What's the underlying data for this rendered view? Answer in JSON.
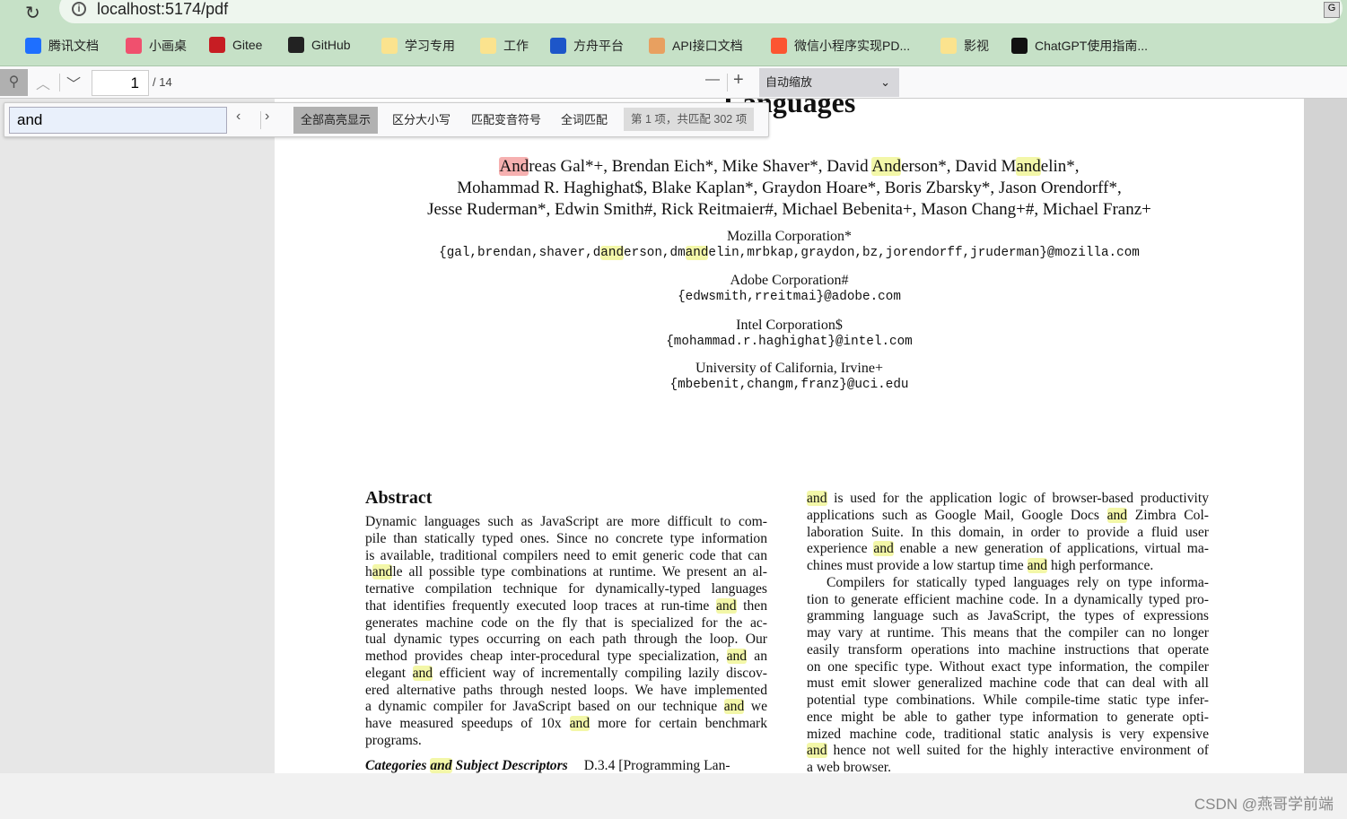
{
  "browser": {
    "url": "localhost:5174/pdf",
    "back": "›",
    "reload": "↻"
  },
  "bookmarks": [
    {
      "label": "腾讯文档",
      "icon": "tencent-docs-icon",
      "color": "#1e6fff"
    },
    {
      "label": "小画桌",
      "icon": "xiaohuazhuo-icon",
      "color": "#f0506e"
    },
    {
      "label": "Gitee",
      "icon": "gitee-icon",
      "color": "#c71d23"
    },
    {
      "label": "GitHub",
      "icon": "github-icon",
      "color": "#222222"
    },
    {
      "label": "学习专用",
      "icon": "folder-icon",
      "color": "#fbe38e"
    },
    {
      "label": "工作",
      "icon": "folder-icon",
      "color": "#fbe38e"
    },
    {
      "label": "方舟平台",
      "icon": "fangzhou-icon",
      "color": "#1d56c9"
    },
    {
      "label": "API接口文档",
      "icon": "doc-icon",
      "color": "#e8a060"
    },
    {
      "label": "微信小程序实现PD...",
      "icon": "csdn-icon",
      "color": "#fc5531"
    },
    {
      "label": "影视",
      "icon": "folder-icon",
      "color": "#fbe38e"
    },
    {
      "label": "ChatGPT使用指南...",
      "icon": "file-icon",
      "color": "#111111"
    }
  ],
  "toolbar": {
    "page": "1",
    "page_total": "/ 14",
    "zoom": "自动缩放",
    "zoom_out": "—",
    "zoom_in": "+"
  },
  "find": {
    "query": "and",
    "highlight_all": "全部高亮显示",
    "match_case": "区分大小写",
    "match_diacritics": "匹配变音符号",
    "whole_words": "全词匹配",
    "result": "第 1 项，共匹配 302 项"
  },
  "paper": {
    "title_fragment": "Languages",
    "authors": [
      [
        {
          "cur": "And"
        },
        "reas Gal*+, Brendan Eich*, Mike Shaver*, David ",
        {
          "hl": "And"
        },
        "erson*, David M",
        {
          "hl": "and"
        },
        "elin*,"
      ],
      [
        "Mohammad R. Haghighat$, Blake Kaplan*, Graydon Hoare*, Boris Zbarsky*, Jason Orendorff*,"
      ],
      [
        "Jesse Ruderman*, Edwin Smith#, Rick Reitmaier#, Michael Bebenita+, Mason Chang+#, Michael Franz+"
      ]
    ],
    "affiliations": [
      {
        "name": "Mozilla Corporation*",
        "emails": [
          "{gal,brendan,shaver,d",
          {
            "hl": "and"
          },
          "erson,dm",
          {
            "hl": "and"
          },
          "elin,mrbkap,graydon,bz,jorendorff,jruderman}@mozilla.com"
        ]
      },
      {
        "name": "Adobe Corporation#",
        "emails": [
          "{edwsmith,rreitmai}@adobe.com"
        ]
      },
      {
        "name": "Intel Corporation$",
        "emails": [
          "{mohammad.r.haghighat}@intel.com"
        ]
      },
      {
        "name": "University of California, Irvine+",
        "emails": [
          "{mbebenit,changm,franz}@uci.edu"
        ]
      }
    ],
    "abstract_heading": "Abstract",
    "abstract_lines": [
      [
        "Dynamic languages such as JavaScript are more difficult to com-"
      ],
      [
        "pile than statically typed ones. Since no concrete type information"
      ],
      [
        "is available, traditional compilers need to emit generic code that can"
      ],
      [
        "h",
        {
          "hl": "and"
        },
        "le all possible type combinations at runtime. We present an al-"
      ],
      [
        "ternative compilation technique for dynamically-typed languages"
      ],
      [
        "that identifies frequently executed loop traces at run-time ",
        {
          "hl": "and"
        },
        " then"
      ],
      [
        "generates machine code on the fly that is specialized for the ac-"
      ],
      [
        "tual dynamic types occurring on each path through the loop. Our"
      ],
      [
        "method provides cheap inter-procedural type specialization, ",
        {
          "hl": "and"
        },
        " an"
      ],
      [
        "elegant ",
        {
          "hl": "and"
        },
        " efficient way of incrementally compiling lazily discov-"
      ],
      [
        "ered alternative paths through nested loops. We have implemented"
      ],
      [
        "a dynamic compiler for JavaScript based on our technique ",
        {
          "hl": "and"
        },
        " we"
      ],
      [
        "have measured speedups of 10x ",
        {
          "hl": "and"
        },
        " more for certain benchmark"
      ],
      [
        "programs."
      ]
    ],
    "categories_line": [
      "Categories ",
      {
        "hl": "and"
      },
      " Subject Descriptors",
      "D.3.4 [Programming Lan-"
    ],
    "right_lines": [
      [
        {
          "hl": "and"
        },
        " is used for the application logic of browser-based productivity"
      ],
      [
        "applications such as Google Mail, Google Docs ",
        {
          "hl": "and"
        },
        " Zimbra Col-"
      ],
      [
        "laboration Suite. In this domain, in order to provide a fluid user"
      ],
      [
        "experience ",
        {
          "hl": "and"
        },
        " enable a new generation of applications, virtual ma-"
      ],
      [
        "chines must provide a low startup time ",
        {
          "hl": "and"
        },
        " high performance."
      ],
      [
        "Compilers for statically typed languages rely on type informa-"
      ],
      [
        "tion to generate efficient machine code. In a dynamically typed pro-"
      ],
      [
        "gramming language such as JavaScript, the types of expressions"
      ],
      [
        "may vary at runtime. This means that the compiler can no longer"
      ],
      [
        "easily transform operations into machine instructions that operate"
      ],
      [
        "on one specific type. Without exact type information, the compiler"
      ],
      [
        "must emit slower generalized machine code that can deal with all"
      ],
      [
        "potential type combinations. While compile-time static type infer-"
      ],
      [
        "ence might be able to gather type information to generate opti-"
      ],
      [
        "mized machine code, traditional static analysis is very expensive"
      ],
      [
        {
          "hl": "and"
        },
        " hence not well suited for the highly interactive environment of"
      ],
      [
        "a web browser."
      ]
    ]
  },
  "watermark": "CSDN @燕哥学前端"
}
